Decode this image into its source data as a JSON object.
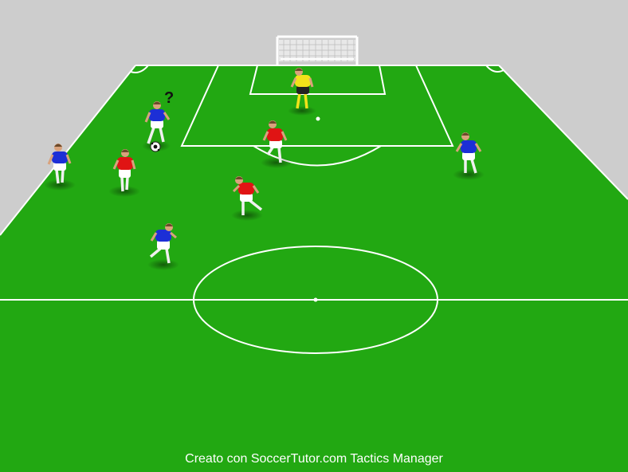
{
  "diagram": {
    "question_mark": "?",
    "footer_text": "Creato con SoccerTutor.com Tactics Manager",
    "colors": {
      "background": "#cdcdcd",
      "grass": "#22a812",
      "lines": "#ffffff",
      "team_blue": "#1c2fd6",
      "team_red": "#e01414",
      "goalkeeper": "#f2e21a"
    },
    "players": [
      {
        "id": "blue-with-ball",
        "team": "blue"
      },
      {
        "id": "blue-left-wing",
        "team": "blue"
      },
      {
        "id": "blue-bottom",
        "team": "blue"
      },
      {
        "id": "blue-right",
        "team": "blue"
      },
      {
        "id": "red-left",
        "team": "red"
      },
      {
        "id": "red-center",
        "team": "red"
      },
      {
        "id": "red-box",
        "team": "red"
      },
      {
        "id": "goalkeeper",
        "team": "goalkeeper"
      }
    ]
  }
}
